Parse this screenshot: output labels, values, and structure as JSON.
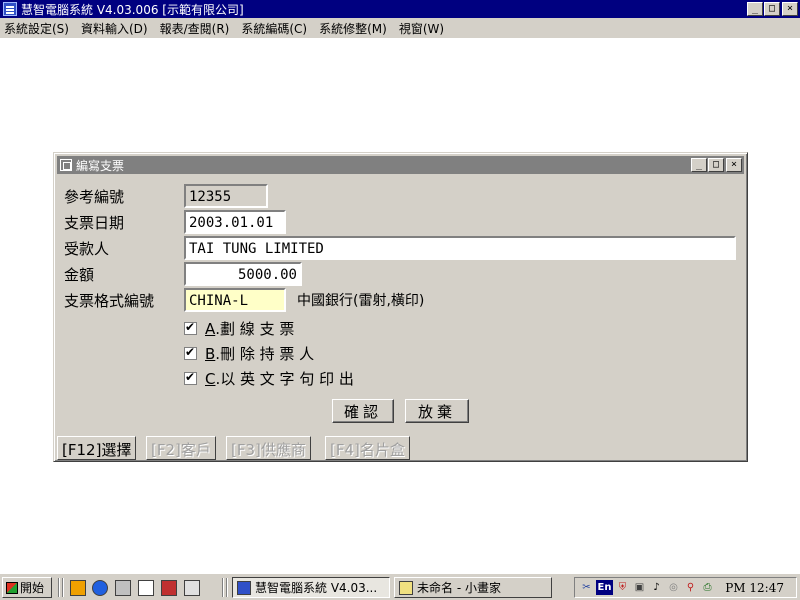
{
  "app": {
    "title": "慧智電腦系統 V4.03.006 [示範有限公司]",
    "window_buttons": {
      "minimize": "_",
      "maximize": "□",
      "close": "×"
    }
  },
  "menu": {
    "items": [
      "系統設定(S)",
      "資料輸入(D)",
      "報表/查閱(R)",
      "系統編碼(C)",
      "系統修整(M)",
      "視窗(W)"
    ]
  },
  "dialog": {
    "title": "編寫支票",
    "fields": {
      "ref_no": {
        "label": "參考編號",
        "value": "12355"
      },
      "date": {
        "label": "支票日期",
        "value": "2003.01.01"
      },
      "payee": {
        "label": "受款人",
        "value": "TAI TUNG LIMITED"
      },
      "amount": {
        "label": "金額",
        "value": "5000.00"
      },
      "format": {
        "label": "支票格式編號",
        "value": "CHINA-L",
        "description": "中國銀行(雷射,橫印)"
      }
    },
    "options": [
      {
        "letter": "A",
        "label": ".劃 線 支 票",
        "checked": true
      },
      {
        "letter": "B",
        "label": ".刪 除 持 票 人",
        "checked": true
      },
      {
        "letter": "C",
        "label": ".以 英 文 字 句 印 出",
        "checked": true
      }
    ],
    "buttons": {
      "confirm": "確認",
      "cancel": "放棄"
    },
    "function_keys": [
      {
        "label": "[F12]選擇",
        "enabled": true
      },
      {
        "label": "[F2]客戶",
        "enabled": false
      },
      {
        "label": "[F3]供應商",
        "enabled": false
      },
      {
        "label": "[F4]名片盒",
        "enabled": false
      }
    ]
  },
  "taskbar": {
    "start_label": "開始",
    "tasks": [
      {
        "label": "慧智電腦系統 V4.03...",
        "active": true
      },
      {
        "label": "未命名 - 小畫家",
        "active": false
      }
    ],
    "tray_lang": "En",
    "clock": "PM 12:47",
    "colors": {
      "title_active": "#000080",
      "title_inactive": "#808080",
      "face": "#d4d0c8",
      "highlight_field": "#ffffc8"
    }
  }
}
